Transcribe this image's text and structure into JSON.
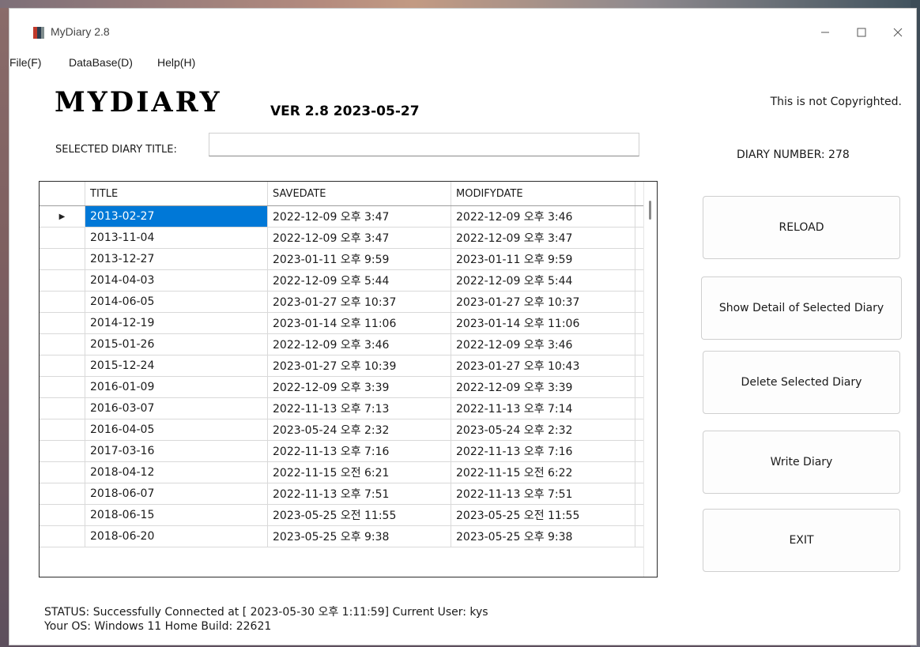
{
  "window": {
    "title": "MyDiary 2.8"
  },
  "menu": [
    "File(F)",
    "DataBase(D)",
    "Help(H)"
  ],
  "header": {
    "logo": "MYDIARY",
    "version": "VER 2.8 2023-05-27",
    "copyright": "This is not Copyrighted.",
    "diary_number": "DIARY NUMBER: 278"
  },
  "selected_title": {
    "label": "SELECTED DIARY TITLE:",
    "value": ""
  },
  "table": {
    "columns": [
      "TITLE",
      "SAVEDATE",
      "MODIFYDATE"
    ],
    "rows": [
      [
        "2013-02-27",
        "2022-12-09 오후 3:47",
        "2022-12-09 오후 3:46"
      ],
      [
        "2013-11-04",
        "2022-12-09 오후 3:47",
        "2022-12-09 오후 3:47"
      ],
      [
        "2013-12-27",
        "2023-01-11 오후 9:59",
        "2023-01-11 오후 9:59"
      ],
      [
        "2014-04-03",
        "2022-12-09 오후 5:44",
        "2022-12-09 오후 5:44"
      ],
      [
        "2014-06-05",
        "2023-01-27 오후 10:37",
        "2023-01-27 오후 10:37"
      ],
      [
        "2014-12-19",
        "2023-01-14 오후 11:06",
        "2023-01-14 오후 11:06"
      ],
      [
        "2015-01-26",
        "2022-12-09 오후 3:46",
        "2022-12-09 오후 3:46"
      ],
      [
        "2015-12-24",
        "2023-01-27 오후 10:39",
        "2023-01-27 오후 10:43"
      ],
      [
        "2016-01-09",
        "2022-12-09 오후 3:39",
        "2022-12-09 오후 3:39"
      ],
      [
        "2016-03-07",
        "2022-11-13 오후 7:13",
        "2022-11-13 오후 7:14"
      ],
      [
        "2016-04-05",
        "2023-05-24 오후 2:32",
        "2023-05-24 오후 2:32"
      ],
      [
        "2017-03-16",
        "2022-11-13 오후 7:16",
        "2022-11-13 오후 7:16"
      ],
      [
        "2018-04-12",
        "2022-11-15 오전 6:21",
        "2022-11-15 오전 6:22"
      ],
      [
        "2018-06-07",
        "2022-11-13 오후 7:51",
        "2022-11-13 오후 7:51"
      ],
      [
        "2018-06-15",
        "2023-05-25 오전 11:55",
        "2023-05-25 오전 11:55"
      ],
      [
        "2018-06-20",
        "2023-05-25 오후 9:38",
        "2023-05-25 오후 9:38"
      ]
    ],
    "selected_row": 0,
    "row_marker": "▶"
  },
  "buttons": {
    "reload": "RELOAD",
    "show_detail": "Show Detail of Selected Diary",
    "delete": "Delete Selected Diary",
    "write": "Write Diary",
    "exit": "EXIT"
  },
  "status": {
    "line1": "STATUS: Successfully Connected at [ 2023-05-30 오후 1:11:59]  Current User: kys",
    "line2": "Your OS: Windows 11 Home Build: 22621"
  },
  "icons": {
    "app": "diary-book-icon",
    "minimize": "minimize-icon",
    "maximize": "maximize-icon",
    "close": "close-icon",
    "row_marker": "row-pointer-icon"
  },
  "colors": {
    "selection": "#0078d7",
    "window_bg": "#ffffff"
  }
}
